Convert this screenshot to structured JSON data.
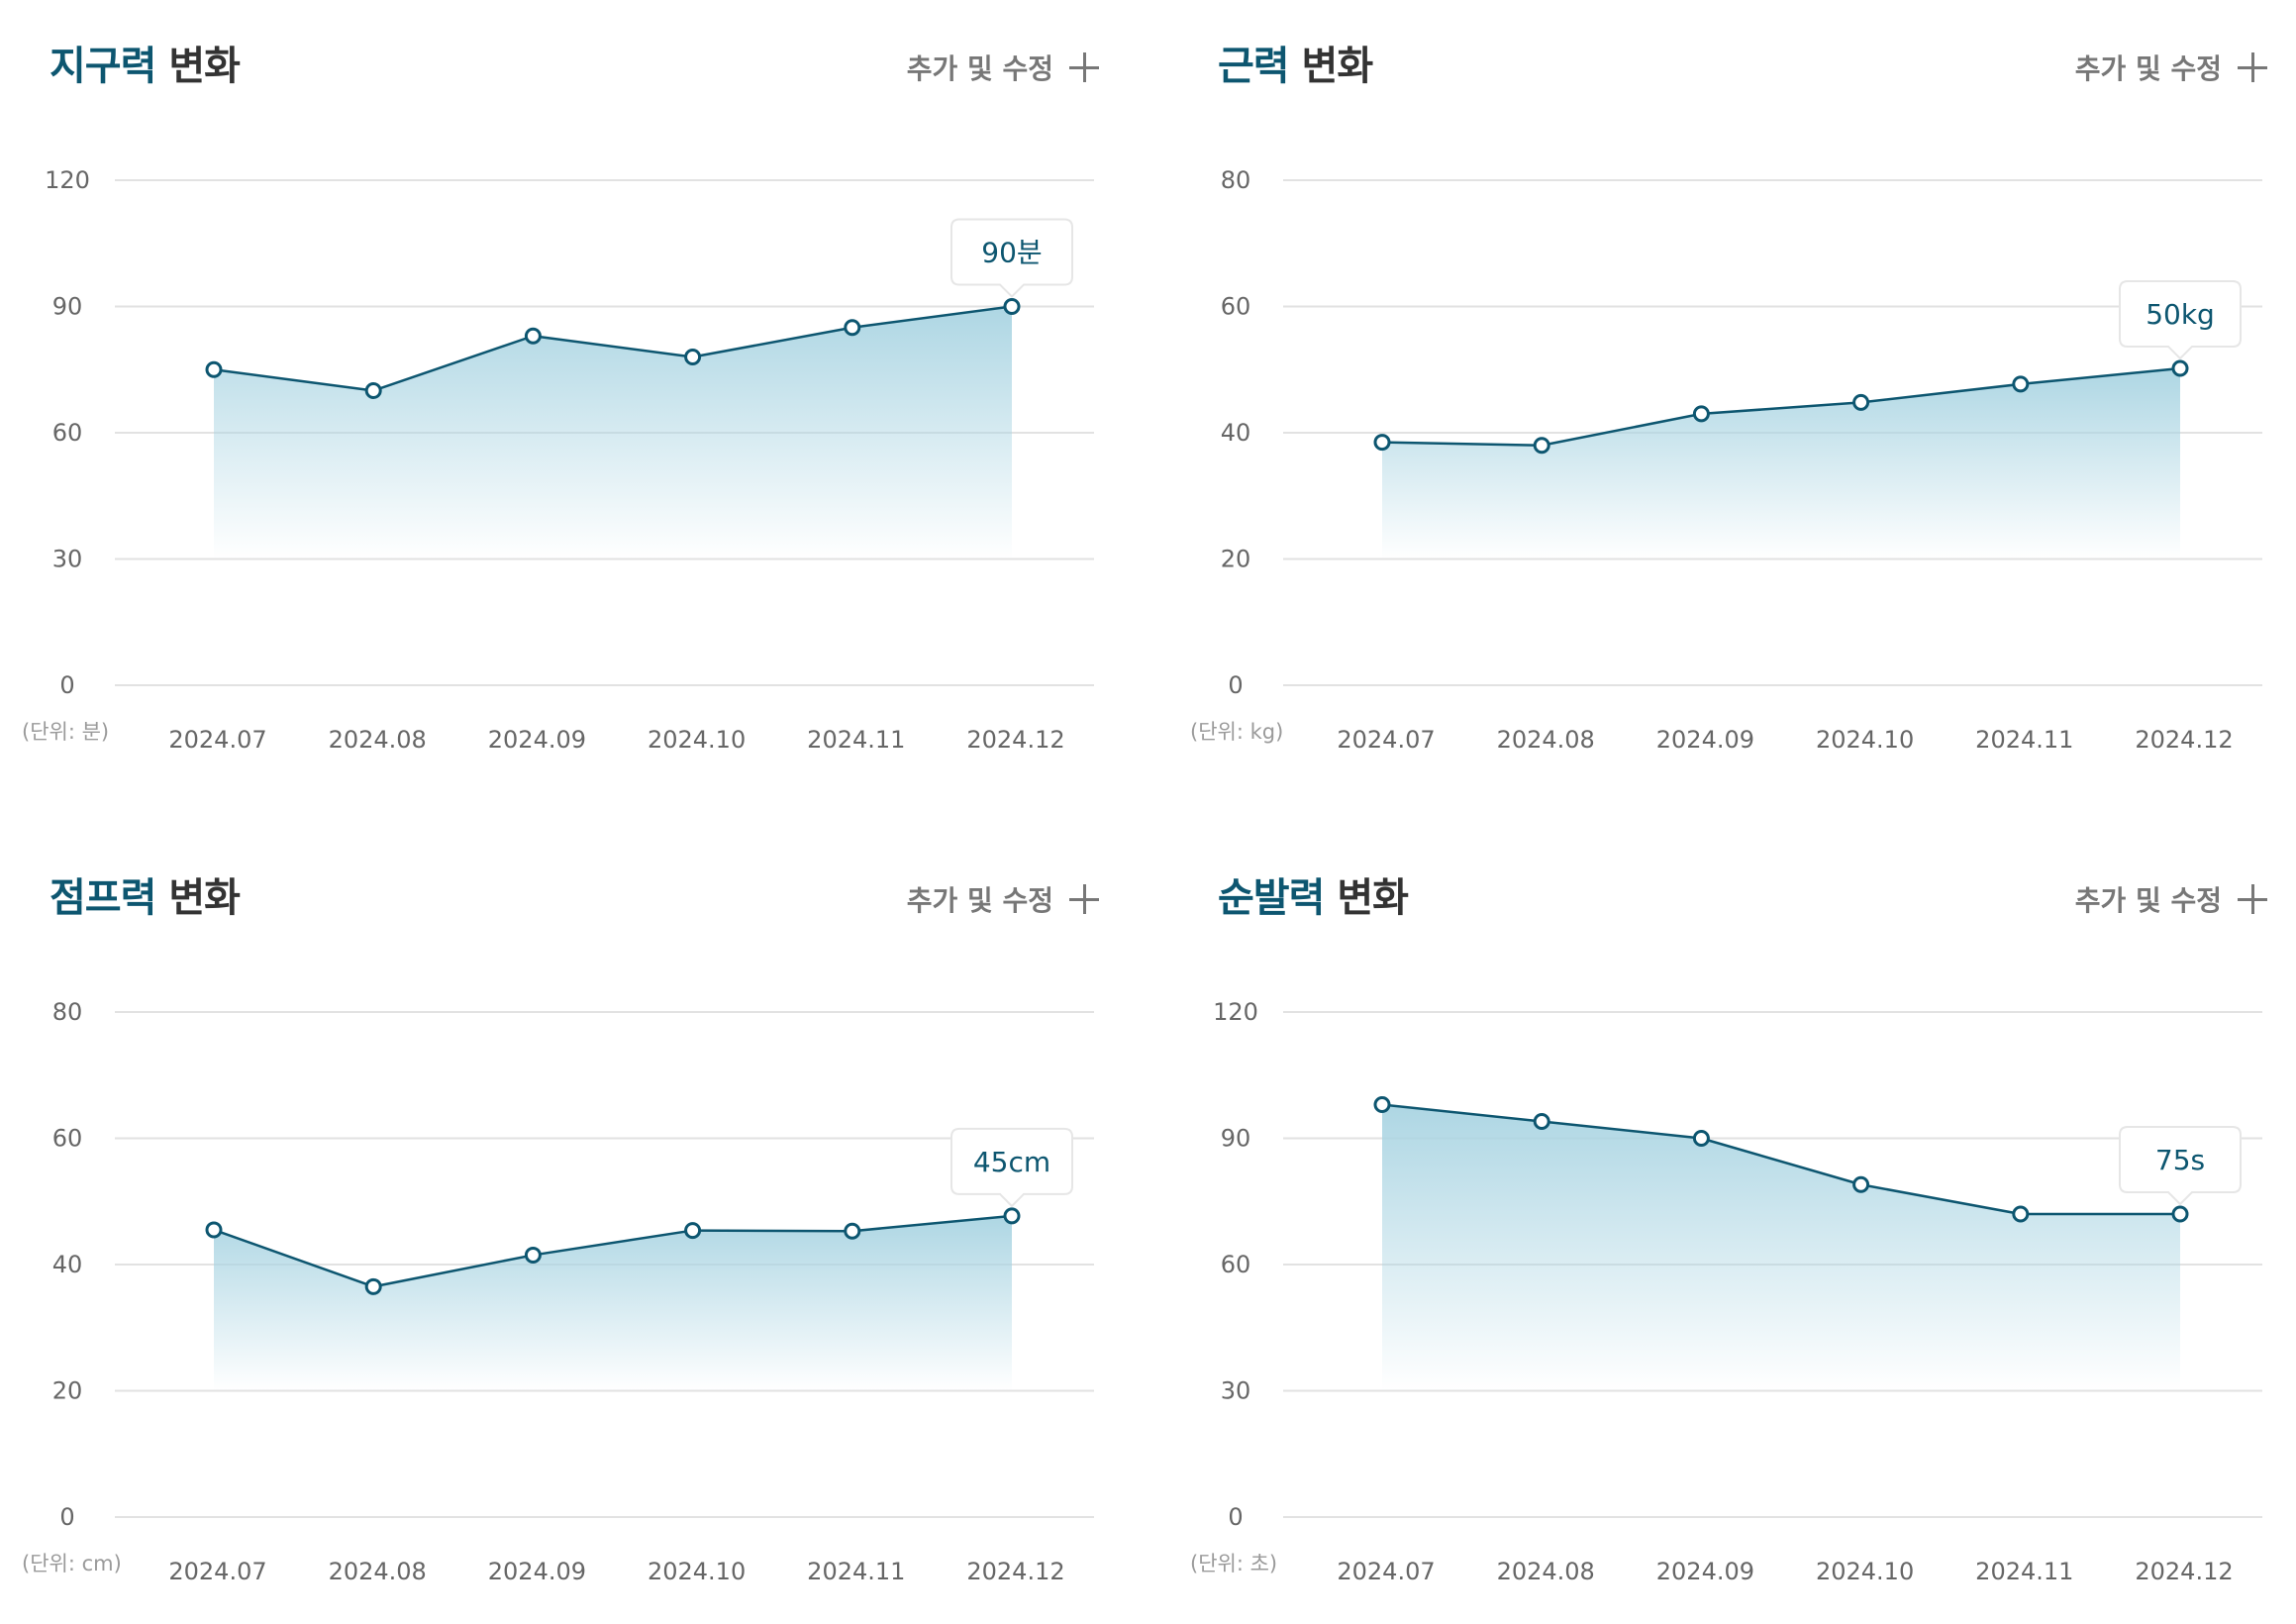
{
  "colors": {
    "accent": "#0d5670",
    "line": "#0d5670",
    "area_top": "#a9d4e2",
    "grid": "#e2e2e2",
    "tick_text": "#666666",
    "muted_text": "#9a9a9a"
  },
  "panels": [
    {
      "title_accent": "지구력",
      "title_rest": " 변화",
      "edit_label": "추가 및 수정",
      "edit_icon": "plus-icon",
      "unit_label": "(단위: 분)",
      "callout": "90분"
    },
    {
      "title_accent": "근력",
      "title_rest": " 변화",
      "edit_label": "추가 및 수정",
      "edit_icon": "plus-icon",
      "unit_label": "(단위: kg)",
      "callout": "50kg"
    },
    {
      "title_accent": "점프력",
      "title_rest": " 변화",
      "edit_label": "추가 및 수정",
      "edit_icon": "plus-icon",
      "unit_label": "(단위: cm)",
      "callout": "45cm"
    },
    {
      "title_accent": "순발력",
      "title_rest": " 변화",
      "edit_label": "추가 및 수정",
      "edit_icon": "plus-icon",
      "unit_label": "(단위: 초)",
      "callout": "75s"
    }
  ],
  "chart_data": [
    {
      "type": "area",
      "title": "지구력 변화",
      "categories": [
        "2024.07",
        "2024.08",
        "2024.09",
        "2024.10",
        "2024.11",
        "2024.12"
      ],
      "values": [
        75,
        70,
        83,
        78,
        85,
        90
      ],
      "ylim": [
        0,
        120
      ],
      "yticks": [
        0,
        30,
        60,
        90,
        120
      ],
      "grid": true,
      "highlight_index": 5
    },
    {
      "type": "area",
      "title": "근력 변화",
      "categories": [
        "2024.07",
        "2024.08",
        "2024.09",
        "2024.10",
        "2024.11",
        "2024.12"
      ],
      "values": [
        38.5,
        38,
        43,
        44.8,
        47.7,
        50.2
      ],
      "ylim": [
        0,
        80
      ],
      "yticks": [
        0,
        20,
        40,
        60,
        80
      ],
      "grid": true,
      "highlight_index": 5
    },
    {
      "type": "area",
      "title": "점프력 변화",
      "categories": [
        "2024.07",
        "2024.08",
        "2024.09",
        "2024.10",
        "2024.11",
        "2024.12"
      ],
      "values": [
        45.5,
        36.5,
        41.5,
        45.4,
        45.3,
        47.7
      ],
      "ylim": [
        0,
        80
      ],
      "yticks": [
        0,
        20,
        40,
        60,
        80
      ],
      "grid": true,
      "highlight_index": 5
    },
    {
      "type": "area",
      "title": "순발력 변화",
      "categories": [
        "2024.07",
        "2024.08",
        "2024.09",
        "2024.10",
        "2024.11",
        "2024.12"
      ],
      "values": [
        98,
        94,
        90,
        79,
        72,
        72
      ],
      "ylim": [
        0,
        120
      ],
      "yticks": [
        0,
        30,
        60,
        90,
        120
      ],
      "grid": true,
      "highlight_index": 5
    }
  ]
}
